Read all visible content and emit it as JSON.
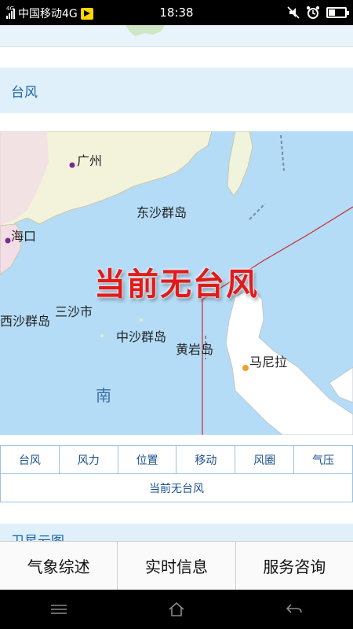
{
  "status_bar": {
    "signal_label": "4G",
    "carrier": "中国移动4G",
    "time": "18:38",
    "icons": [
      "signal-icon",
      "flag-icon",
      "mute-icon",
      "alarm-icon",
      "battery-icon"
    ]
  },
  "typhoon_section": {
    "title": "台风",
    "map": {
      "notice": "当前无台风",
      "labels": {
        "guangzhou": "广州",
        "haikou": "海口",
        "dongsha": "东沙群岛",
        "sansha": "三沙市",
        "xisha": "西沙群岛",
        "zhongsha": "中沙群岛",
        "huangyan": "黄岩岛",
        "manila": "马尼拉",
        "nan": "南"
      },
      "colors": {
        "sea": "#b4dcf6",
        "land": "#eef2d6",
        "warning_line": "#d32a2a",
        "notice": "#e11b1b"
      }
    },
    "table": {
      "headers": [
        "台风",
        "风力",
        "位置",
        "移动",
        "风圈",
        "气压"
      ],
      "empty_message": "当前无台风"
    }
  },
  "next_section": {
    "title": "卫星云图"
  },
  "tab_bar": {
    "tabs": [
      "气象综述",
      "实时信息",
      "服务咨询"
    ]
  },
  "nav_bar": {
    "icons": [
      "menu-icon",
      "home-icon",
      "back-icon"
    ]
  }
}
